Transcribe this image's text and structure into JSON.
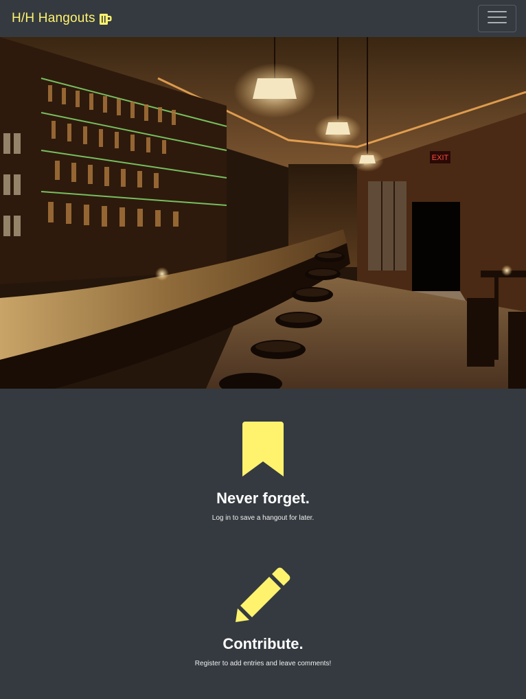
{
  "navbar": {
    "brand": "H/H Hangouts",
    "brand_icon": "beer-mug-icon",
    "toggler_icon": "hamburger-menu-icon"
  },
  "hero": {
    "image": "bar-interior-photo",
    "sign_text": "EXIT"
  },
  "features": [
    {
      "icon": "bookmark-icon",
      "title": "Never forget.",
      "text": "Log in to save a hangout for later."
    },
    {
      "icon": "pencil-icon",
      "title": "Contribute.",
      "text": "Register to add entries and leave comments!"
    }
  ],
  "colors": {
    "background": "#343a40",
    "accent": "#fff36e",
    "text": "#ffffff"
  }
}
